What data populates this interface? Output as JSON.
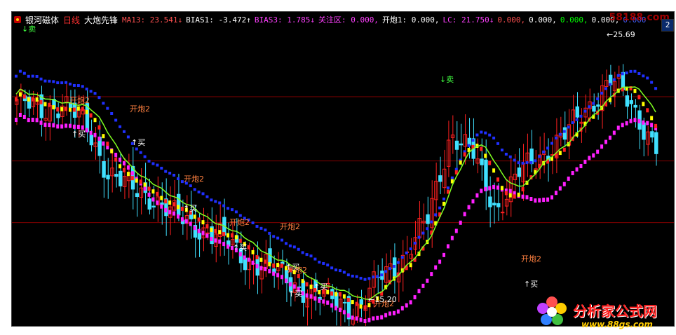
{
  "header": {
    "name": "银河磁体",
    "period": "日线",
    "indicator": "大炮先锋",
    "items": [
      {
        "label": "MA13: 23.541",
        "arrow": "↓",
        "color": "#ff5050"
      },
      {
        "label": "BIAS1: -3.472",
        "arrow": "↑",
        "color": "#ffffff"
      },
      {
        "label": "BIAS3: 1.785",
        "arrow": "↓",
        "color": "#ff40ff"
      },
      {
        "label": "关注区: 0.000,",
        "arrow": "",
        "color": "#ff40ff"
      },
      {
        "label": "开炮1: 0.000,",
        "arrow": "",
        "color": "#ffffff"
      },
      {
        "label": "LC: 21.750",
        "arrow": "↓",
        "color": "#ff40ff"
      },
      {
        "label": "0.000,",
        "arrow": "",
        "color": "#ff5050"
      },
      {
        "label": "0.000,",
        "arrow": "",
        "color": "#ffffff"
      },
      {
        "label": "0.000,",
        "arrow": "",
        "color": "#00ff00"
      },
      {
        "label": "0.000,",
        "arrow": "",
        "color": "#ffffff"
      },
      {
        "label": "0.000",
        "arrow": "",
        "color": "#4060ff"
      }
    ]
  },
  "side_button": "2",
  "watermark": "58188.com",
  "logo": {
    "title": "分析家公式网",
    "url": "www.88gs.com"
  },
  "annotations": {
    "high_label": "25.69",
    "low_label": "15.20",
    "buy": "↑买",
    "sell": "↓卖",
    "fire": "开炮2"
  },
  "chart_data": {
    "type": "candlestick",
    "price_range": [
      14.8,
      26.2
    ],
    "gridlines": [
      23.5,
      21.0,
      18.6
    ],
    "sample_closes": [
      23.4,
      22.9,
      23.3,
      22.4,
      20.6,
      19.9,
      19.6,
      18.8,
      18.4,
      18.0,
      17.2,
      16.9,
      16.3,
      15.8,
      15.6,
      15.2,
      16.6,
      17.3,
      18.7,
      22.1,
      21.2,
      19.1,
      20.5,
      21.3,
      22.0,
      23.1,
      24.2,
      23.0,
      21.6
    ],
    "colors": {
      "up": "#ff2020",
      "down": "#40e0ff",
      "ma_yellow": "#ffff00",
      "ma_red": "#ff2020",
      "ma_magenta": "#ff20ff",
      "ma_blue": "#2030ff",
      "ma_green": "#80ff20"
    }
  }
}
